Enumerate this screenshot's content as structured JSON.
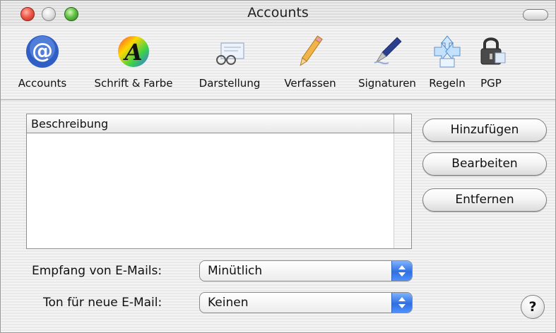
{
  "window": {
    "title": "Accounts"
  },
  "toolbar": {
    "items": [
      {
        "label": "Accounts",
        "icon": "at-sign-icon"
      },
      {
        "label": "Schrift & Farbe",
        "icon": "font-color-icon"
      },
      {
        "label": "Darstellung",
        "icon": "viewing-glasses-icon"
      },
      {
        "label": "Verfassen",
        "icon": "pencil-icon"
      },
      {
        "label": "Signaturen",
        "icon": "fountain-pen-icon"
      },
      {
        "label": "Regeln",
        "icon": "rules-arrows-icon"
      },
      {
        "label": "PGP",
        "icon": "lock-icon"
      }
    ]
  },
  "accounts_list": {
    "column_header": "Beschreibung",
    "rows": []
  },
  "buttons": {
    "add": "Hinzufügen",
    "edit": "Bearbeiten",
    "remove": "Entfernen"
  },
  "form": {
    "check_mail_label": "Empfang von E-Mails:",
    "check_mail_value": "Minütlich",
    "new_mail_sound_label": "Ton für neue E-Mail:",
    "new_mail_sound_value": "Keinen"
  },
  "help": {
    "glyph": "?"
  },
  "colors": {
    "accent_blue": "#2f6fe0",
    "close_red": "#f05a4a",
    "zoom_green": "#62c247"
  }
}
